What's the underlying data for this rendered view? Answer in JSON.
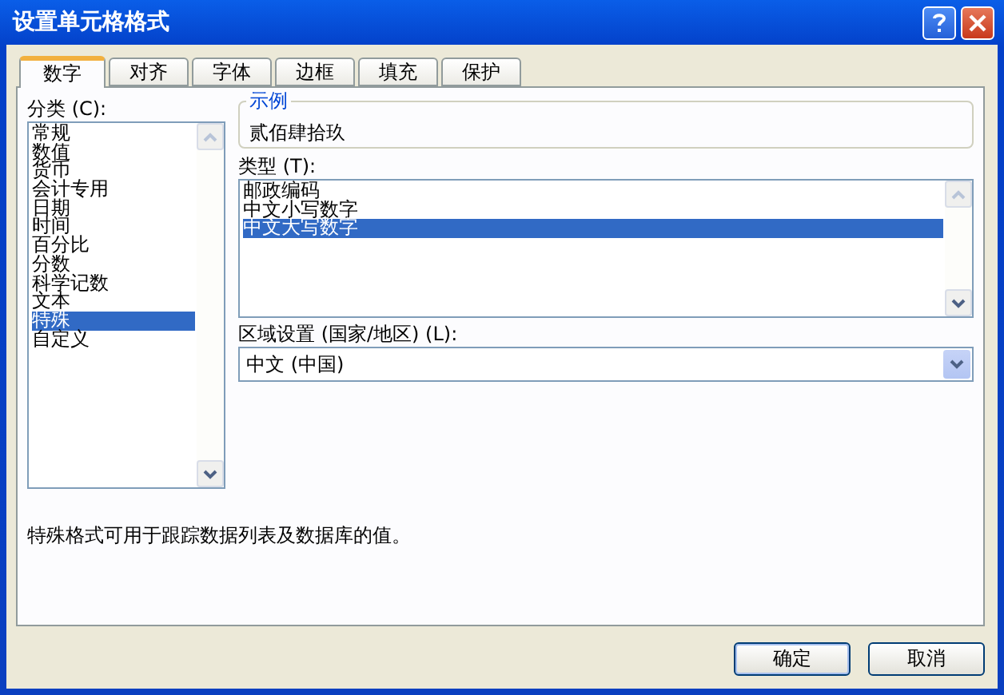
{
  "window": {
    "title": "设置单元格格式"
  },
  "tabs": [
    {
      "label": "数字",
      "selected": true
    },
    {
      "label": "对齐",
      "selected": false
    },
    {
      "label": "字体",
      "selected": false
    },
    {
      "label": "边框",
      "selected": false
    },
    {
      "label": "填充",
      "selected": false
    },
    {
      "label": "保护",
      "selected": false
    }
  ],
  "category": {
    "label": "分类 (C):",
    "items": [
      {
        "label": "常规",
        "selected": false
      },
      {
        "label": "数值",
        "selected": false
      },
      {
        "label": "货币",
        "selected": false
      },
      {
        "label": "会计专用",
        "selected": false
      },
      {
        "label": "日期",
        "selected": false
      },
      {
        "label": "时间",
        "selected": false
      },
      {
        "label": "百分比",
        "selected": false
      },
      {
        "label": "分数",
        "selected": false
      },
      {
        "label": "科学记数",
        "selected": false
      },
      {
        "label": "文本",
        "selected": false
      },
      {
        "label": "特殊",
        "selected": true
      },
      {
        "label": "自定义",
        "selected": false
      }
    ]
  },
  "sample": {
    "legend": "示例",
    "value": "贰佰肆拾玖"
  },
  "type": {
    "label": "类型 (T):",
    "items": [
      {
        "label": "邮政编码",
        "selected": false
      },
      {
        "label": "中文小写数字",
        "selected": false
      },
      {
        "label": "中文大写数字",
        "selected": true
      }
    ]
  },
  "locale": {
    "label": "区域设置 (国家/地区) (L):",
    "value": "中文 (中国)"
  },
  "description": "特殊格式可用于跟踪数据列表及数据库的值。",
  "buttons": [
    "确定",
    "取消"
  ]
}
